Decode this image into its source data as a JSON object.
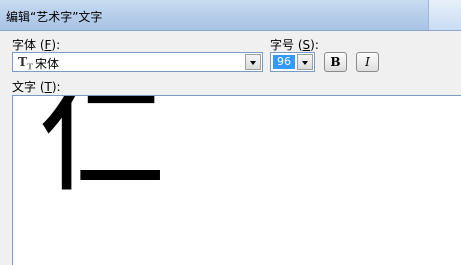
{
  "window": {
    "title": "编辑“艺术字”文字"
  },
  "font": {
    "label": "字体",
    "accel": "F",
    "value": "宋体",
    "type_icon": "truetype-icon"
  },
  "size": {
    "label": "字号",
    "accel": "S",
    "value": "96"
  },
  "format": {
    "bold_label": "B",
    "italic_label": "I"
  },
  "text": {
    "label": "文字",
    "accel": "T",
    "value": "仁"
  }
}
